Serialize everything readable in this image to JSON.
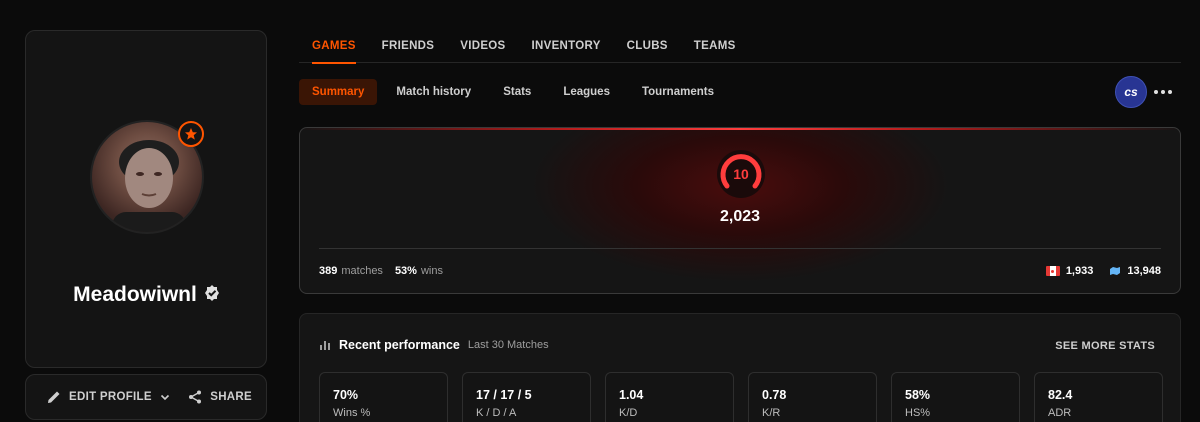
{
  "profile": {
    "username": "Meadowiwnl",
    "actions": {
      "edit_label": "EDIT PROFILE",
      "share_label": "SHARE"
    }
  },
  "top_nav": {
    "tabs": [
      "GAMES",
      "FRIENDS",
      "VIDEOS",
      "INVENTORY",
      "CLUBS",
      "TEAMS"
    ],
    "active": "GAMES"
  },
  "sub_nav": {
    "tabs": [
      "Summary",
      "Match history",
      "Stats",
      "Leagues",
      "Tournaments"
    ],
    "active": "Summary"
  },
  "game": {
    "badge_text": "cs"
  },
  "elo": {
    "level": "10",
    "elo_value": "2,023",
    "matches": "389",
    "matches_label": "matches",
    "wins_pct": "53%",
    "wins_label": "wins",
    "country_rank": "1,933",
    "region_rank": "13,948"
  },
  "performance": {
    "title": "Recent performance",
    "subtitle": "Last 30 Matches",
    "see_more": "SEE MORE STATS",
    "stats": [
      {
        "value": "70%",
        "label": "Wins %"
      },
      {
        "value": "17 / 17 / 5",
        "label": "K / D / A"
      },
      {
        "value": "1.04",
        "label": "K/D"
      },
      {
        "value": "0.78",
        "label": "K/R"
      },
      {
        "value": "58%",
        "label": "HS%"
      },
      {
        "value": "82.4",
        "label": "ADR"
      }
    ]
  },
  "colors": {
    "accent": "#ff5500",
    "level_red": "#ff3d3d",
    "background": "#0b0b0b",
    "card": "#141414"
  }
}
